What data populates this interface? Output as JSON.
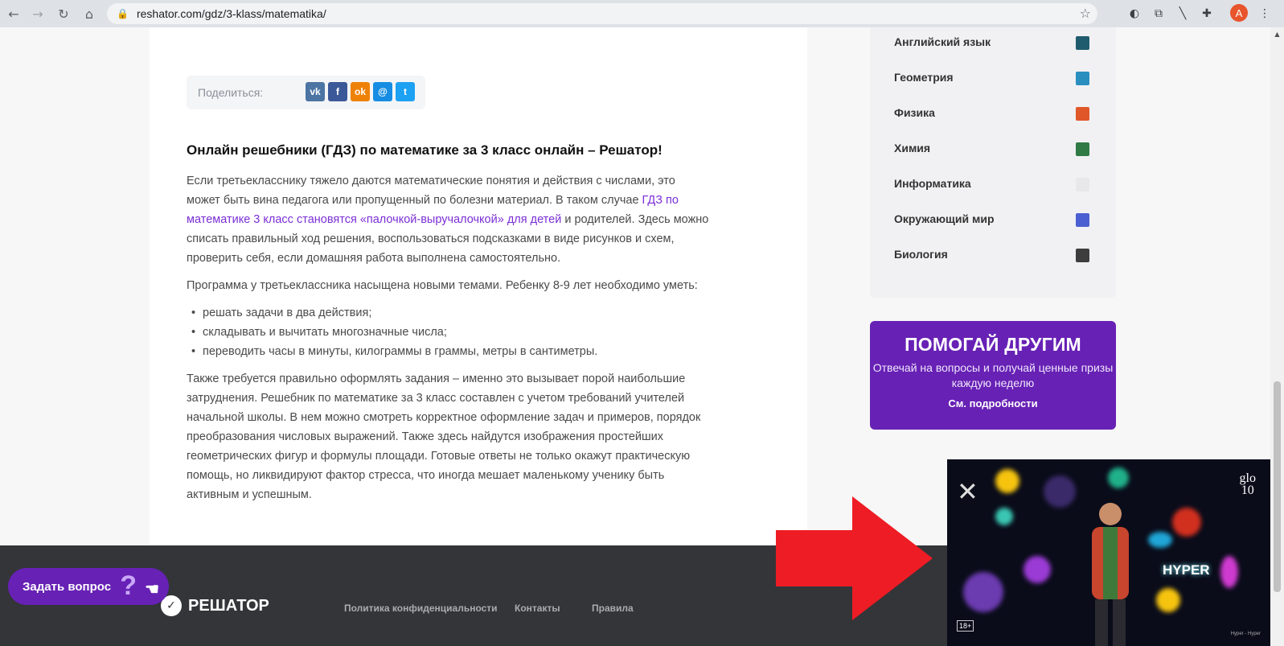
{
  "browser": {
    "url": "reshator.com/gdz/3-klass/matematika/",
    "avatar_letter": "A"
  },
  "share": {
    "label": "Поделиться:",
    "buttons": [
      {
        "name": "vk",
        "glyph": "vk",
        "color": "#4c75a3"
      },
      {
        "name": "facebook",
        "glyph": "f",
        "color": "#3b5998"
      },
      {
        "name": "odnoklassniki",
        "glyph": "ok",
        "color": "#ee8208"
      },
      {
        "name": "moimir",
        "glyph": "@",
        "color": "#168de2"
      },
      {
        "name": "twitter",
        "glyph": "t",
        "color": "#1da1f2"
      }
    ]
  },
  "article": {
    "heading": "Онлайн решебники (ГДЗ) по математике за 3 класс онлайн – Решатор!",
    "p1_before": "Если третьекласснику тяжело даются математические понятия и действия с числами, это может быть вина педагога или пропущенный по болезни материал. В таком случае ",
    "p1_link": "ГДЗ по математике 3 класс становятся «палочкой-выручалочкой» для детей",
    "p1_after": " и родителей. Здесь можно списать правильный ход решения, воспользоваться подсказками в виде рисунков и схем, проверить себя, если домашняя работа выполнена самостоятельно.",
    "p2": "Программа у третьеклассника насыщена новыми темами. Ребенку 8-9 лет необходимо уметь:",
    "list": [
      "решать задачи в два действия;",
      "складывать и вычитать многозначные числа;",
      "переводить часы в минуты, килограммы в граммы, метры в сантиметры."
    ],
    "p3": "Также требуется правильно оформлять задания – именно это вызывает порой наибольшие затруднения. Решебник по математике за 3 класс составлен с учетом требований учителей начальной школы. В нем можно смотреть корректное оформление задач и примеров, порядок преобразования числовых выражений. Также здесь найдутся изображения простейших геометрических фигур и формулы площади. Готовые ответы не только окажут практическую помощь, но ликвидируют фактор стресса, что иногда мешает маленькому ученику быть активным и успешным."
  },
  "sidebar": {
    "subjects": [
      {
        "label": "Английский язык",
        "color": "#1f5c6e"
      },
      {
        "label": "Геометрия",
        "color": "#2a8fbf"
      },
      {
        "label": "Физика",
        "color": "#e0572a"
      },
      {
        "label": "Химия",
        "color": "#2f7a45"
      },
      {
        "label": "Информатика",
        "color": "#e8e8ea"
      },
      {
        "label": "Окружающий мир",
        "color": "#4a5fd1"
      },
      {
        "label": "Биология",
        "color": "#3d3d3d"
      }
    ]
  },
  "promo": {
    "title": "ПОМОГАЙ ДРУГИМ",
    "text": "Отвечай на вопросы и получай ценные призы каждую неделю",
    "more": "См. подробности"
  },
  "footer": {
    "logo": "РЕШАТОР",
    "links": [
      "Политика конфиденциальности",
      "Контакты",
      "Правила"
    ]
  },
  "ask": {
    "label": "Задать вопрос",
    "glyph": "?"
  },
  "video_ad": {
    "brand_top": "glo",
    "brand_num": "10",
    "hyper": "HYPER",
    "age": "18+",
    "caption": "Hyper - Hyper"
  }
}
